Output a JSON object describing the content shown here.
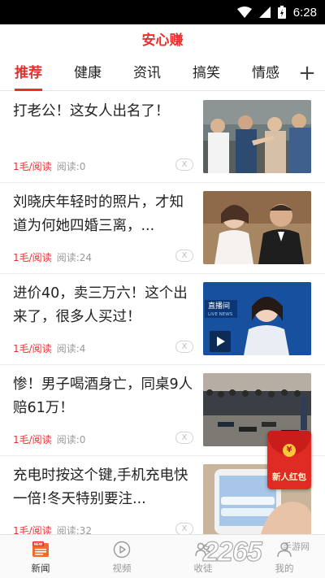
{
  "status_bar": {
    "time": "6:28"
  },
  "app": {
    "title": "安心赚"
  },
  "tabs": [
    {
      "label": "推荐"
    },
    {
      "label": "健康"
    },
    {
      "label": "资讯"
    },
    {
      "label": "搞笑"
    },
    {
      "label": "情感"
    }
  ],
  "tab_add_label": "+",
  "news": [
    {
      "title": "打老公！这女人出名了！",
      "reward": "1毛/阅读",
      "reads": "阅读:0",
      "dismiss": "X"
    },
    {
      "title": "刘晓庆年轻时的照片，才知道为何她四婚三离，...",
      "reward": "1毛/阅读",
      "reads": "阅读:24",
      "dismiss": "X"
    },
    {
      "title": "进价40，卖三万六！这个出来了，很多人买过！",
      "reward": "1毛/阅读",
      "reads": "阅读:4",
      "dismiss": "X"
    },
    {
      "title": "惨！男子喝酒身亡，同桌9人赔61万！",
      "reward": "1毛/阅读",
      "reads": "阅读:0",
      "dismiss": "X"
    },
    {
      "title": "充电时按这个键,手机充电快一倍!冬天特别要注...",
      "reward": "1毛/阅读",
      "reads": "阅读:32",
      "dismiss": "X"
    }
  ],
  "thumb_text": {
    "news_channel": "直播间",
    "live": "LIVE NEWS"
  },
  "red_packet": {
    "label": "新人红包",
    "coin": "¥"
  },
  "bottom_nav": [
    {
      "label": "新闻",
      "badge": "NEW"
    },
    {
      "label": "视频"
    },
    {
      "label": "收徒"
    },
    {
      "label": "我的"
    }
  ],
  "watermark": {
    "digits": "2265",
    "sub": "手游网"
  },
  "colors": {
    "accent": "#e8302f",
    "muted": "#999999"
  }
}
